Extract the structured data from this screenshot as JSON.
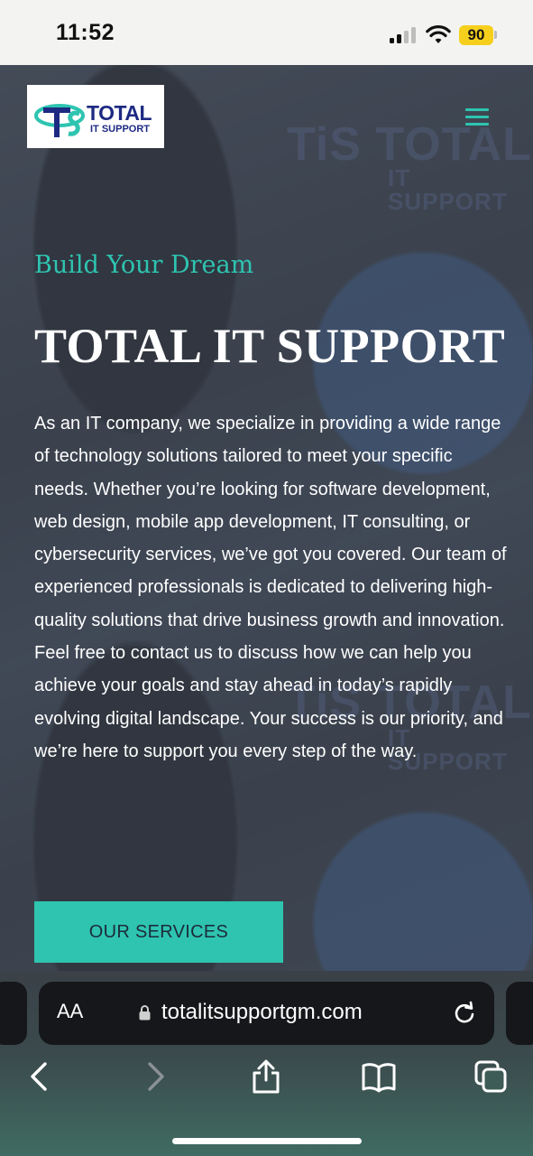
{
  "status_bar": {
    "time": "11:52",
    "battery": "90",
    "battery_color": "#f5cf1c"
  },
  "site": {
    "logo": {
      "mark": "TIS",
      "title": "TOTAL",
      "subtitle": "IT SUPPORT"
    },
    "menu_icon": "hamburger-menu-icon",
    "accent_color": "#2ec4b0",
    "hero": {
      "tagline": "Build Your Dream",
      "title": "TOTAL IT SUPPORT",
      "body": "As an IT company, we specialize in providing a wide range of technology solutions tailored to meet your specific needs. Whether you’re looking for software development, web design, mobile app development, IT consulting, or cybersecurity services, we’ve got you covered. Our team of experienced professionals is dedicated to delivering high-quality solutions that drive business growth and innovation. Feel free to contact us to discuss how we can help you achieve your goals and stay ahead in today’s rapidly evolving digital landscape. Your success is our priority, and we’re here to support you every step of the way.",
      "cta_label": "OUR SERVICES"
    }
  },
  "browser": {
    "text_size_label": "AA",
    "url": "totalitsupportgm.com",
    "toolbar_icons": [
      "back-arrow-icon",
      "forward-arrow-icon",
      "share-icon",
      "bookmarks-icon",
      "tabs-icon"
    ]
  }
}
